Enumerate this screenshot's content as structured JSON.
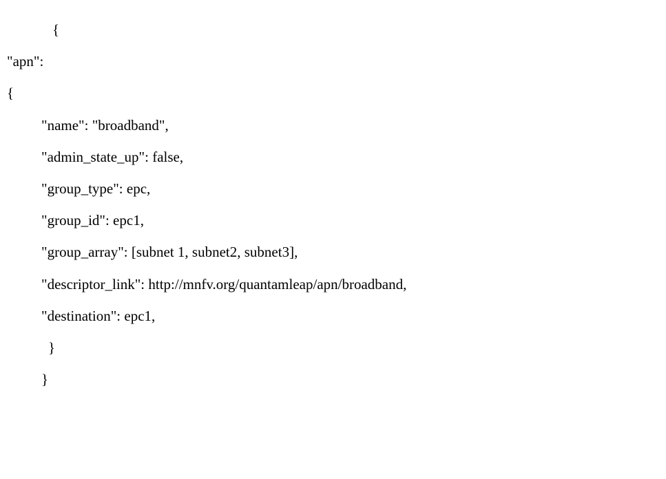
{
  "code": {
    "line1": "{",
    "line2": "\"apn\":",
    "line3": "{",
    "line4": "\"name\": \"broadband\",",
    "line5": "\"admin_state_up\": false,",
    "line6": "\"group_type\": epc,",
    "line7": "\"group_id\": epc1,",
    "line8": "\"group_array\": [subnet 1, subnet2, subnet3],",
    "line9": "\"descriptor_link\": http://mnfv.org/quantamleap/apn/broadband,",
    "line10": "\"destination\": epc1,",
    "line11": "}",
    "line12": "}"
  }
}
